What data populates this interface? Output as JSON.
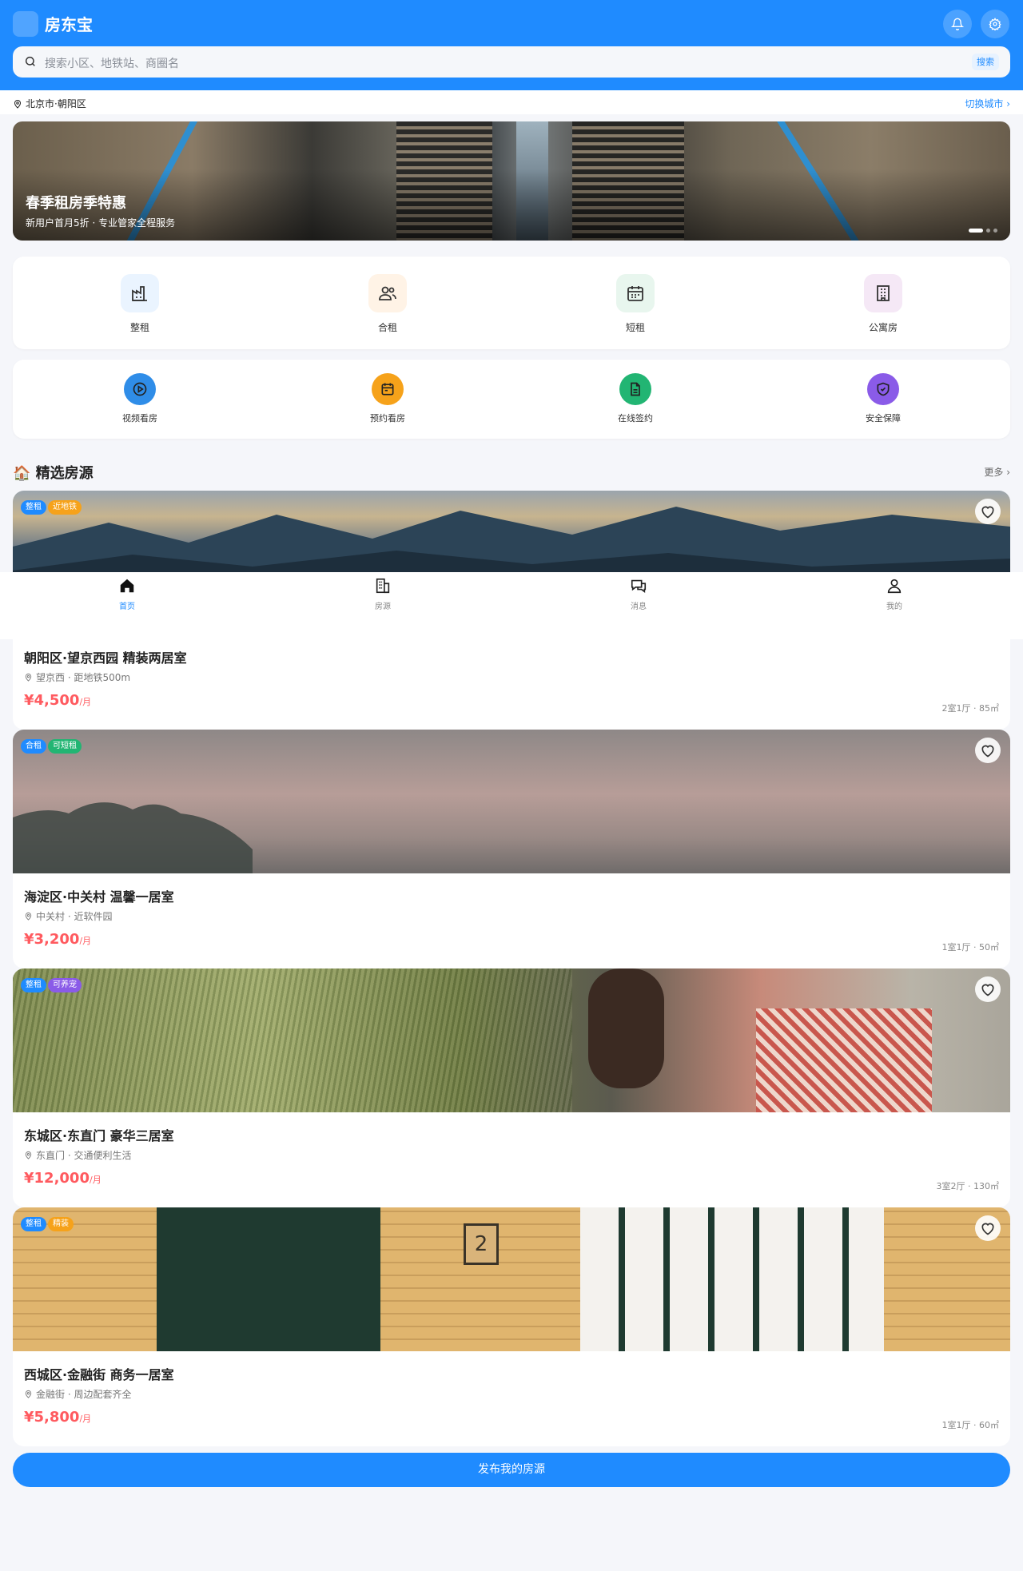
{
  "header": {
    "logo_glyph": "",
    "title": "房东宝"
  },
  "search": {
    "placeholder": "搜索小区、地铁站、商圈名",
    "button": "搜索"
  },
  "location": {
    "city": "北京市·朝阳区",
    "switch_label": "切换城市 ›"
  },
  "banner": {
    "title": "春季租房季特惠",
    "subtitle": "新用户首月5折 · 专业管家全程服务"
  },
  "categories": [
    {
      "label": "整租",
      "icon": "factory-icon",
      "bg": "#eaf4ff"
    },
    {
      "label": "合租",
      "icon": "users-icon",
      "bg": "#fff3e6"
    },
    {
      "label": "短租",
      "icon": "calendar-icon",
      "bg": "#e8f6ee"
    },
    {
      "label": "公寓房",
      "icon": "building-icon",
      "bg": "#f5e8f6"
    }
  ],
  "services": [
    {
      "label": "视频看房",
      "icon": "play-icon",
      "color": "#2f8de8"
    },
    {
      "label": "预约看房",
      "icon": "calendar-icon",
      "color": "#f6a21a"
    },
    {
      "label": "在线签约",
      "icon": "document-icon",
      "color": "#22b573"
    },
    {
      "label": "安全保障",
      "icon": "shield-icon",
      "color": "#8a5be8"
    }
  ],
  "section": {
    "title": "🏠 精选房源",
    "more": "更多 ›"
  },
  "listings": [
    {
      "tags": [
        {
          "text": "整租",
          "color": "#1f8bff"
        },
        {
          "text": "近地铁",
          "color": "#f6a21a"
        }
      ],
      "title": "朝阳区·望京西园 精装两居室",
      "address": "望京西 · 距地铁500m",
      "price": "¥4,500",
      "unit": "/月",
      "meta": "2室1厅 · 85㎡"
    },
    {
      "tags": [
        {
          "text": "合租",
          "color": "#1f8bff"
        },
        {
          "text": "可短租",
          "color": "#22b573"
        }
      ],
      "title": "海淀区·中关村 温馨一居室",
      "address": "中关村 · 近软件园",
      "price": "¥3,200",
      "unit": "/月",
      "meta": "1室1厅 · 50㎡"
    },
    {
      "tags": [
        {
          "text": "整租",
          "color": "#1f8bff"
        },
        {
          "text": "可养宠",
          "color": "#8a5be8"
        }
      ],
      "title": "东城区·东直门 豪华三居室",
      "address": "东直门 · 交通便利生活",
      "price": "¥12,000",
      "unit": "/月",
      "meta": "3室2厅 · 130㎡"
    },
    {
      "tags": [
        {
          "text": "整租",
          "color": "#1f8bff"
        },
        {
          "text": "精装",
          "color": "#f6a21a"
        }
      ],
      "title": "西城区·金融街 商务一居室",
      "address": "金融街 · 周边配套齐全",
      "price": "¥5,800",
      "unit": "/月",
      "meta": "1室1厅 · 60㎡"
    }
  ],
  "bottom_nav": [
    {
      "label": "首页",
      "icon": "home-icon",
      "active": true
    },
    {
      "label": "房源",
      "icon": "building-icon",
      "active": false
    },
    {
      "label": "消息",
      "icon": "chat-icon",
      "active": false
    },
    {
      "label": "我的",
      "icon": "user-icon",
      "active": false
    }
  ],
  "publish_button": "发布我的房源",
  "colors": {
    "primary": "#1f8bff",
    "price": "#ff5a5f",
    "background": "#f5f6fa"
  }
}
